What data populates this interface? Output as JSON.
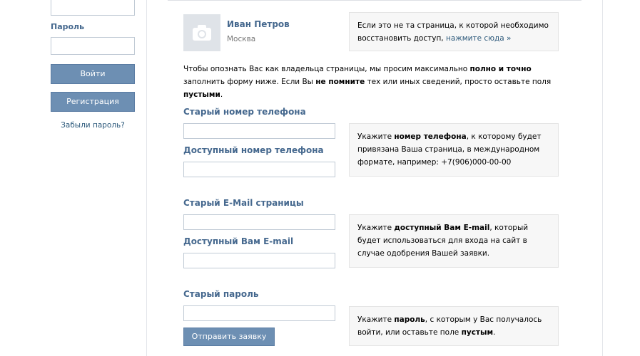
{
  "sidebar": {
    "password_label": "Пароль",
    "login_button": "Войти",
    "register_button": "Регистрация",
    "forgot_link": "Забыли пароль?"
  },
  "profile": {
    "name": "Иван Петров",
    "city": "Москва",
    "notice_text": "Если это не та страница, к которой необходимо восстановить доступ,",
    "notice_link": "нажмите сюда »"
  },
  "intro": {
    "t1": "Чтобы опознать Вас как владельца страницы, мы просим максимально ",
    "b1": "полно и точно",
    "t2": " заполнить форму ниже. Если Вы ",
    "b2": "не помните",
    "t3": " тех или иных сведений, просто оставьте поля ",
    "b3": "пустыми",
    "t4": "."
  },
  "phone": {
    "old_label": "Старый номер телефона",
    "new_label": "Доступный номер телефона",
    "hint_t1": "Укажите ",
    "hint_b1": "номер телефона",
    "hint_t2": ", к которому будет привязана Ваша страница, в международном формате, например: +7(906)000-00-00"
  },
  "email": {
    "old_label": "Старый E-Mail страницы",
    "new_label": "Доступный Вам E-mail",
    "hint_t1": "Укажите ",
    "hint_b1": "доступный Вам E-mail",
    "hint_t2": ", который будет использоваться для входа на сайт в случае одобрения Вашей заявки."
  },
  "password": {
    "old_label": "Старый пароль",
    "submit_button": "Отправить заявку",
    "hint_t1": "Укажите ",
    "hint_b1": "пароль",
    "hint_t2": ", с которым у Вас получалось войти, или оставьте поле ",
    "hint_b2": "пустым",
    "hint_t3": "."
  },
  "icons": {
    "avatar": "camera-icon"
  },
  "colors": {
    "accent": "#45688e",
    "button": "#6d8fb3",
    "link": "#2b587a"
  }
}
